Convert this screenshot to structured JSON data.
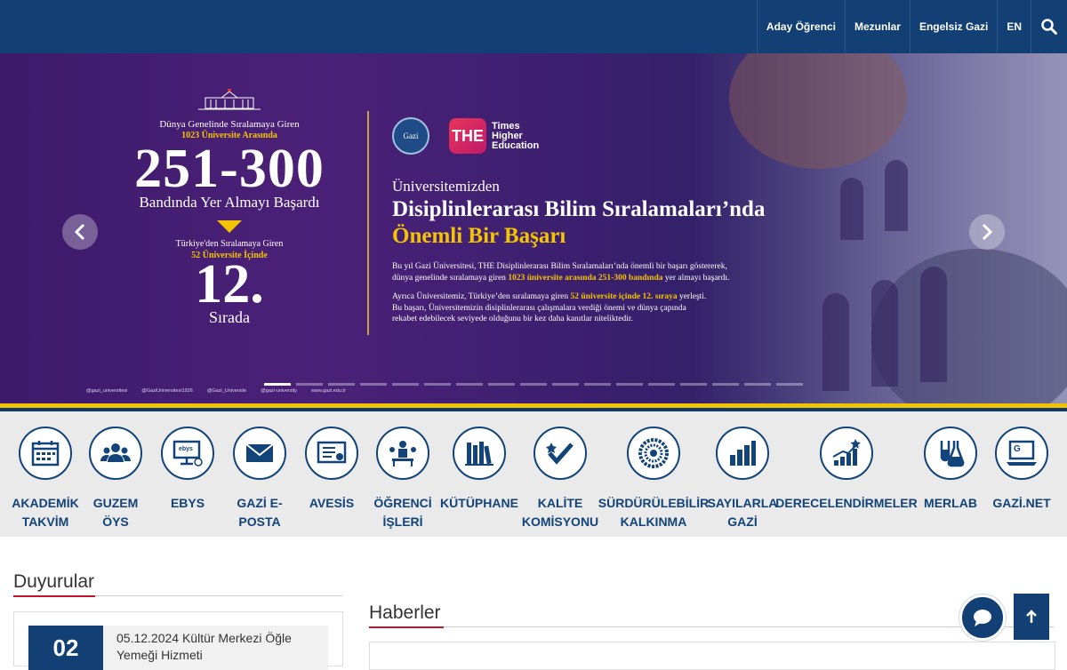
{
  "topnav": {
    "items": [
      {
        "label": "Aday Öğrenci"
      },
      {
        "label": "Mezunlar"
      },
      {
        "label": "Engelsiz Gazi"
      },
      {
        "label": "EN"
      }
    ],
    "search_icon": "search-icon"
  },
  "hero": {
    "left": {
      "line1": "Dünya Genelinde Sıralamaya Giren",
      "line2": "1023 Üniversite Arasında",
      "big": "251-300",
      "band": "Bandında Yer Almayı Başardı",
      "line3": "Türkiye'den Sıralamaya Giren",
      "line4": "52 Üniversite İçinde",
      "rank": "12.",
      "sira": "Sırada"
    },
    "logo_text": [
      "Times",
      "Higher",
      "Education"
    ],
    "the_mark": "THE",
    "headline1": "Üniversitemizden",
    "headline2": "Disiplinlerarası Bilim Sıralamaları’nda",
    "headline3": "Önemli Bir Başarı",
    "p1a": "Bu yıl Gazi Üniversitesi, THE Disiplinlerarası Bilim Sıralamaları’nda önemli bir başarı göstererek,",
    "p1b": "dünya genelinde sıralamaya giren ",
    "p1c": "1023 üniversite arasında 251-300 bandında",
    "p1d": " yer almayı başardı.",
    "p2a": "Ayrıca Üniversitemiz, Türkiye’den sıralamaya giren ",
    "p2b": "52 üniversite içinde 12. sıraya",
    "p2c": " yerleşti.",
    "p3": "Bu başarı, Üniversitemizin disiplinlerarası çalışmalara verdiği önemi ve dünya çapında",
    "p4": "rekabet edebilecek seviyede olduğunu bir kez daha kanıtlar niteliktedir.",
    "social": [
      "@gazi_universitesi",
      "@GaziUniversitesi1926",
      "@Gazi_Universite",
      "@gazi-university",
      "www.gazi.edu.tr"
    ],
    "dots_count": 17,
    "active_dot": 0
  },
  "quick_links": [
    {
      "label1": "AKADEMİK",
      "label2": "TAKVİM",
      "icon": "calendar-icon"
    },
    {
      "label1": "GUZEM",
      "label2": "ÖYS",
      "icon": "users-icon"
    },
    {
      "label1": "EBYS",
      "label2": "",
      "icon": "monitor-icon"
    },
    {
      "label1": "GAZİ E-",
      "label2": "POSTA",
      "icon": "envelope-icon"
    },
    {
      "label1": "AVESİS",
      "label2": "",
      "icon": "certificate-icon"
    },
    {
      "label1": "ÖĞRENCİ",
      "label2": "İŞLERİ",
      "icon": "student-icon"
    },
    {
      "label1": "KÜTÜPHANE",
      "label2": "",
      "icon": "books-icon"
    },
    {
      "label1": "KALİTE",
      "label2": "KOMİSYONU",
      "icon": "quality-check-icon"
    },
    {
      "label1": "SÜRDÜRÜLEBİLİR",
      "label2": "KALKINMA",
      "icon": "sdg-wheel-icon"
    },
    {
      "label1": "SAYILARLA",
      "label2": "GAZİ",
      "icon": "bar-chart-icon"
    },
    {
      "label1": "DERECELENDİRMELER",
      "label2": "",
      "icon": "growth-chart-icon"
    },
    {
      "label1": "MERLAB",
      "label2": "",
      "icon": "lab-flask-icon"
    },
    {
      "label1": "GAZİ.NET",
      "label2": "",
      "icon": "laptop-icon"
    }
  ],
  "duyurular": {
    "title": "Duyurular",
    "items": [
      {
        "day": "02",
        "text": "05.12.2024 Kültür Merkezi Öğle Yemeği Hizmeti"
      }
    ]
  },
  "haberler": {
    "title": "Haberler"
  }
}
